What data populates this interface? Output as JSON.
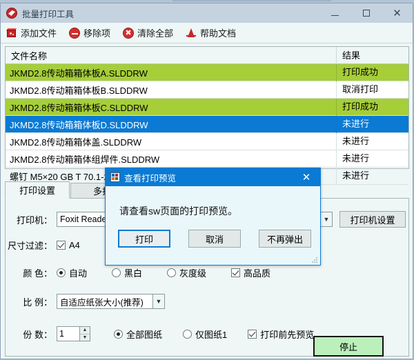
{
  "window": {
    "title": "批量打印工具",
    "icon": "app-disc-icon",
    "minimize": "—",
    "maximize": "□",
    "close": "✕"
  },
  "toolbar": {
    "items": [
      {
        "label": "添加文件",
        "icon": "red-cube-icon"
      },
      {
        "label": "移除项",
        "icon": "remove-circle-icon"
      },
      {
        "label": "清除全部",
        "icon": "clear-all-circle-icon"
      },
      {
        "label": "帮助文档",
        "icon": "pdf-icon"
      }
    ]
  },
  "file_list": {
    "columns": [
      "文件名称",
      "结果"
    ],
    "rows": [
      {
        "name": "JKMD2.8传动箱箱体板A.SLDDRW",
        "result": "打印成功",
        "state": "success"
      },
      {
        "name": "JKMD2.8传动箱箱体板B.SLDDRW",
        "result": "取消打印",
        "state": "normal"
      },
      {
        "name": "JKMD2.8传动箱箱体板C.SLDDRW",
        "result": "打印成功",
        "state": "success"
      },
      {
        "name": "JKMD2.8传动箱箱体板D.SLDDRW",
        "result": "未进行",
        "state": "selected"
      },
      {
        "name": "JKMD2.8传动箱箱体盖.SLDDRW",
        "result": "未进行",
        "state": "normal"
      },
      {
        "name": "JKMD2.8传动箱箱体组焊件.SLDDRW",
        "result": "未进行",
        "state": "normal"
      },
      {
        "name": "螺钉 M5×20 GB T 70.1-2000.SLDDRW",
        "result": "未进行",
        "state": "normal"
      }
    ]
  },
  "tabs": [
    {
      "label": "打印设置",
      "active": true
    },
    {
      "label": "多打",
      "active": false
    }
  ],
  "settings": {
    "printer_label": "打印机：",
    "printer_value": "Foxit Reader",
    "printer_settings_button": "打印机设置",
    "size_filter_label": "尺寸过滤：",
    "size_filter_a4": "A4",
    "color_label": "颜 色：",
    "color_options": [
      "自动",
      "黑白",
      "灰度级"
    ],
    "color_selected": "自动",
    "high_quality_label": "高品质",
    "high_quality_checked": true,
    "scale_label": "比 例：",
    "scale_value": "自适应纸张大小(推荐)",
    "copies_label": "份 数：",
    "copies_value": "1",
    "sheet_options": [
      "全部图纸",
      "仅图纸1"
    ],
    "sheet_selected": "全部图纸",
    "preview_before_print_label": "打印前先预览",
    "preview_before_print_checked": true,
    "stop_button": "停止"
  },
  "dialog": {
    "title": "查看打印预览",
    "icon": "app-window-icon",
    "close": "✕",
    "message": "请查看sw页面的打印预览。",
    "buttons": [
      {
        "label": "打印",
        "default": true
      },
      {
        "label": "取消",
        "default": false
      },
      {
        "label": "不再弹出",
        "default": false
      }
    ]
  },
  "colors": {
    "title_bar": "#c5d3e0",
    "success_row": "#a6ce39",
    "selected_row": "#0a7ad4",
    "dialog_accent": "#0a7ad4",
    "stop_button": "#bbf0bb"
  }
}
